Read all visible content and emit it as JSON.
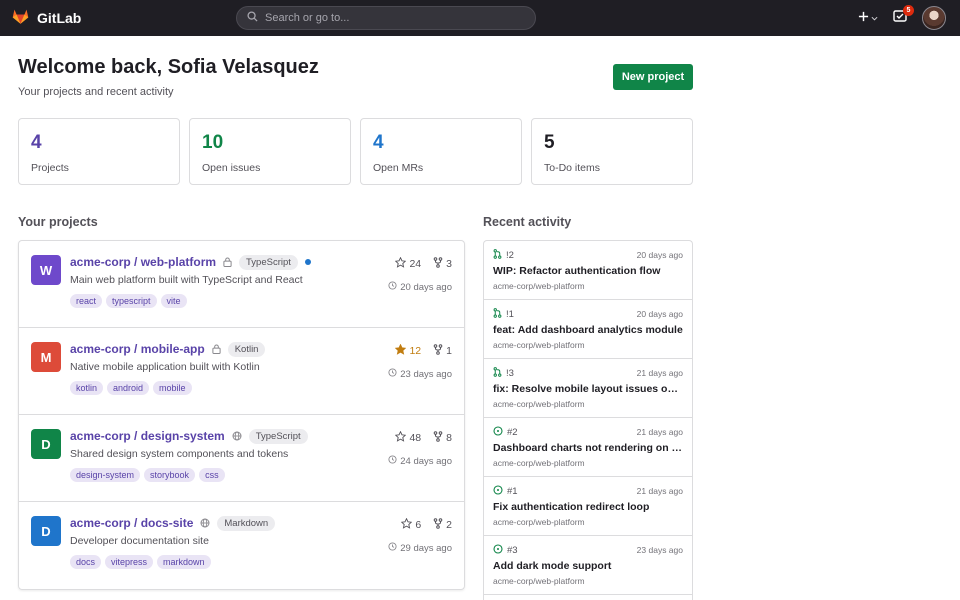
{
  "app": {
    "name": "GitLab"
  },
  "search": {
    "placeholder": "Search or go to..."
  },
  "notifications": {
    "todo_count": "5"
  },
  "header": {
    "title": "Welcome back, Sofia Velasquez",
    "subtitle": "Your projects and recent activity",
    "new_project_label": "New project"
  },
  "stats": [
    {
      "value": "4",
      "label": "Projects",
      "color": "#5943a8"
    },
    {
      "value": "10",
      "label": "Open issues",
      "color": "#108548"
    },
    {
      "value": "4",
      "label": "Open MRs",
      "color": "#1f75cb"
    },
    {
      "value": "5",
      "label": "To-Do items",
      "color": "#1f1e24"
    }
  ],
  "projects_section": {
    "title": "Your projects",
    "items": [
      {
        "initial": "W",
        "avatar_color": "#6e49cb",
        "name": "acme-corp / web-platform",
        "visibility": "lock",
        "language": "TypeScript",
        "lang_dot": true,
        "description": "Main web platform built with TypeScript and React",
        "tags": [
          "react",
          "typescript",
          "vite"
        ],
        "stars": "24",
        "forks": "3",
        "starred": false,
        "updated": "20 days ago"
      },
      {
        "initial": "M",
        "avatar_color": "#dd4b39",
        "name": "acme-corp / mobile-app",
        "visibility": "lock",
        "language": "Kotlin",
        "lang_dot": false,
        "description": "Native mobile application built with Kotlin",
        "tags": [
          "kotlin",
          "android",
          "mobile"
        ],
        "stars": "12",
        "forks": "1",
        "starred": true,
        "updated": "23 days ago"
      },
      {
        "initial": "D",
        "avatar_color": "#108548",
        "name": "acme-corp / design-system",
        "visibility": "globe",
        "language": "TypeScript",
        "lang_dot": false,
        "description": "Shared design system components and tokens",
        "tags": [
          "design-system",
          "storybook",
          "css"
        ],
        "stars": "48",
        "forks": "8",
        "starred": false,
        "updated": "24 days ago"
      },
      {
        "initial": "D",
        "avatar_color": "#1f75cb",
        "name": "acme-corp / docs-site",
        "visibility": "globe",
        "language": "Markdown",
        "lang_dot": false,
        "description": "Developer documentation site",
        "tags": [
          "docs",
          "vitepress",
          "markdown"
        ],
        "stars": "6",
        "forks": "2",
        "starred": false,
        "updated": "29 days ago"
      }
    ]
  },
  "activity_section": {
    "title": "Recent activity",
    "items": [
      {
        "kind": "mr",
        "ref": "!2",
        "time": "20 days ago",
        "title": "WIP: Refactor authentication flow",
        "repo": "acme-corp/web-platform"
      },
      {
        "kind": "mr",
        "ref": "!1",
        "time": "20 days ago",
        "title": "feat: Add dashboard analytics module",
        "repo": "acme-corp/web-platform"
      },
      {
        "kind": "mr",
        "ref": "!3",
        "time": "21 days ago",
        "title": "fix: Resolve mobile layout issues on se...",
        "repo": "acme-corp/web-platform"
      },
      {
        "kind": "issue",
        "ref": "#2",
        "time": "21 days ago",
        "title": "Dashboard charts not rendering on Saf...",
        "repo": "acme-corp/web-platform"
      },
      {
        "kind": "issue",
        "ref": "#1",
        "time": "21 days ago",
        "title": "Fix authentication redirect loop",
        "repo": "acme-corp/web-platform"
      },
      {
        "kind": "issue",
        "ref": "#3",
        "time": "23 days ago",
        "title": "Add dark mode support",
        "repo": "acme-corp/web-platform"
      }
    ]
  }
}
